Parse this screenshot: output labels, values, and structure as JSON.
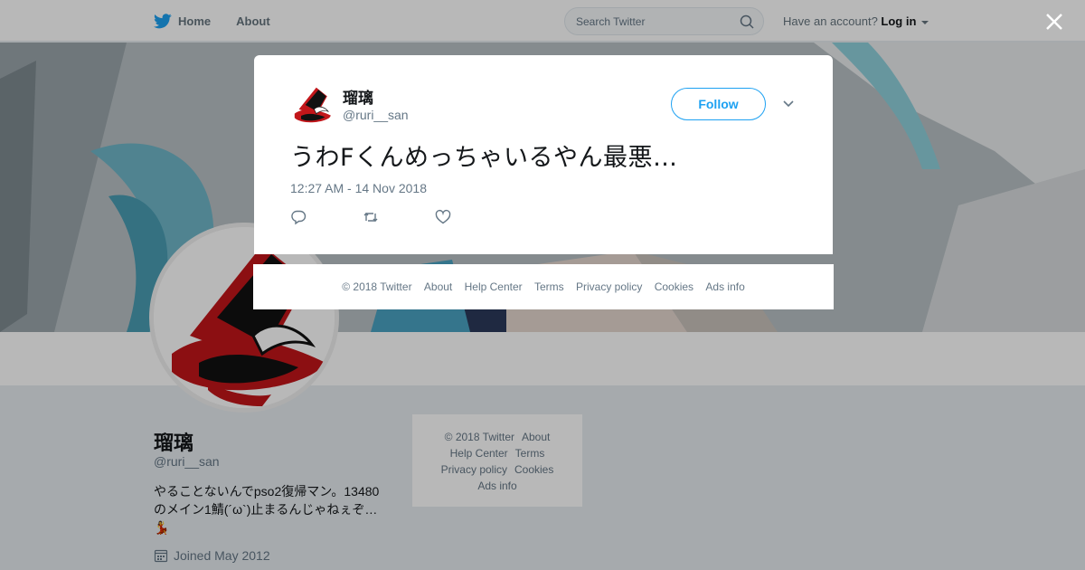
{
  "nav": {
    "home": "Home",
    "about": "About",
    "search_placeholder": "Search Twitter",
    "have_account": "Have an account?",
    "login": "Log in"
  },
  "tweet": {
    "name": "瑠璃",
    "handle": "@ruri__san",
    "follow": "Follow",
    "text": "うわFくんめっちゃいるやん最悪…",
    "timestamp": "12:27 AM - 14 Nov 2018"
  },
  "modal_footer": [
    "© 2018 Twitter",
    "About",
    "Help Center",
    "Terms",
    "Privacy policy",
    "Cookies",
    "Ads info"
  ],
  "profile": {
    "name": "瑠璃",
    "handle": "@ruri__san",
    "bio_line1": "やることないんでpso2復帰マン。13480",
    "bio_line2": "のメイン1鯖(´ω`)止まるんじゃねぇぞ…",
    "bio_line3": "💃",
    "joined": "Joined May 2012"
  },
  "side_footer": {
    "row1": [
      "© 2018 Twitter",
      "About"
    ],
    "row2": [
      "Help Center",
      "Terms"
    ],
    "row3": [
      "Privacy policy",
      "Cookies"
    ],
    "row4": [
      "Ads info"
    ]
  },
  "colors": {
    "accent": "#1da1f2",
    "muted": "#657786",
    "text": "#14171a"
  }
}
